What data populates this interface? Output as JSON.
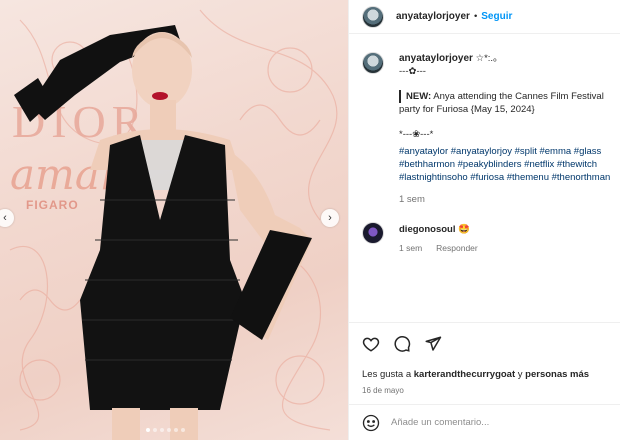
{
  "post": {
    "username": "anyataylorjoyer",
    "follow_label": "Seguir",
    "header_dot": "•"
  },
  "media": {
    "backdrop_text_1": "DIOR",
    "backdrop_text_2": "amar",
    "backdrop_text_3": "FIGARO",
    "nav_prev": "‹",
    "nav_next": "›",
    "slide_count": 6,
    "active_slide": 1
  },
  "caption": {
    "username": "anyataylorjoyer",
    "name_suffix": " ☆*:.｡",
    "divider": "---✿---",
    "news_label": "NEW:",
    "news_text": " Anya attending the Cannes Film Festival",
    "news_text_2": "party for Furiosa {May 15, 2024}",
    "divider_2": "*---❀---*",
    "hashtag_lines": [
      "#anyataylor #anyataylorjoy #split #emma #glass",
      "#bethharmon #peakyblinders #netflix #thewitch",
      "#lastnightinsoho #furiosa #themenu #thenorthman"
    ],
    "time": "1 sem"
  },
  "comment": {
    "username": "diegonosoul",
    "emoji": "🤩",
    "time": "1 sem",
    "reply_label": "Responder"
  },
  "actions": {
    "icons": [
      "heart-icon",
      "comment-icon",
      "share-icon"
    ],
    "likes_prefix": "Les gusta a ",
    "likes_user": "karterandthecurrygoat",
    "likes_suffix": " y ",
    "likes_others": "personas más",
    "date": "16 de mayo"
  },
  "add_comment": {
    "placeholder": "Añade un comentario..."
  },
  "colors": {
    "accent": "#0095f6",
    "hashtag": "#00376b",
    "muted": "#737373"
  }
}
